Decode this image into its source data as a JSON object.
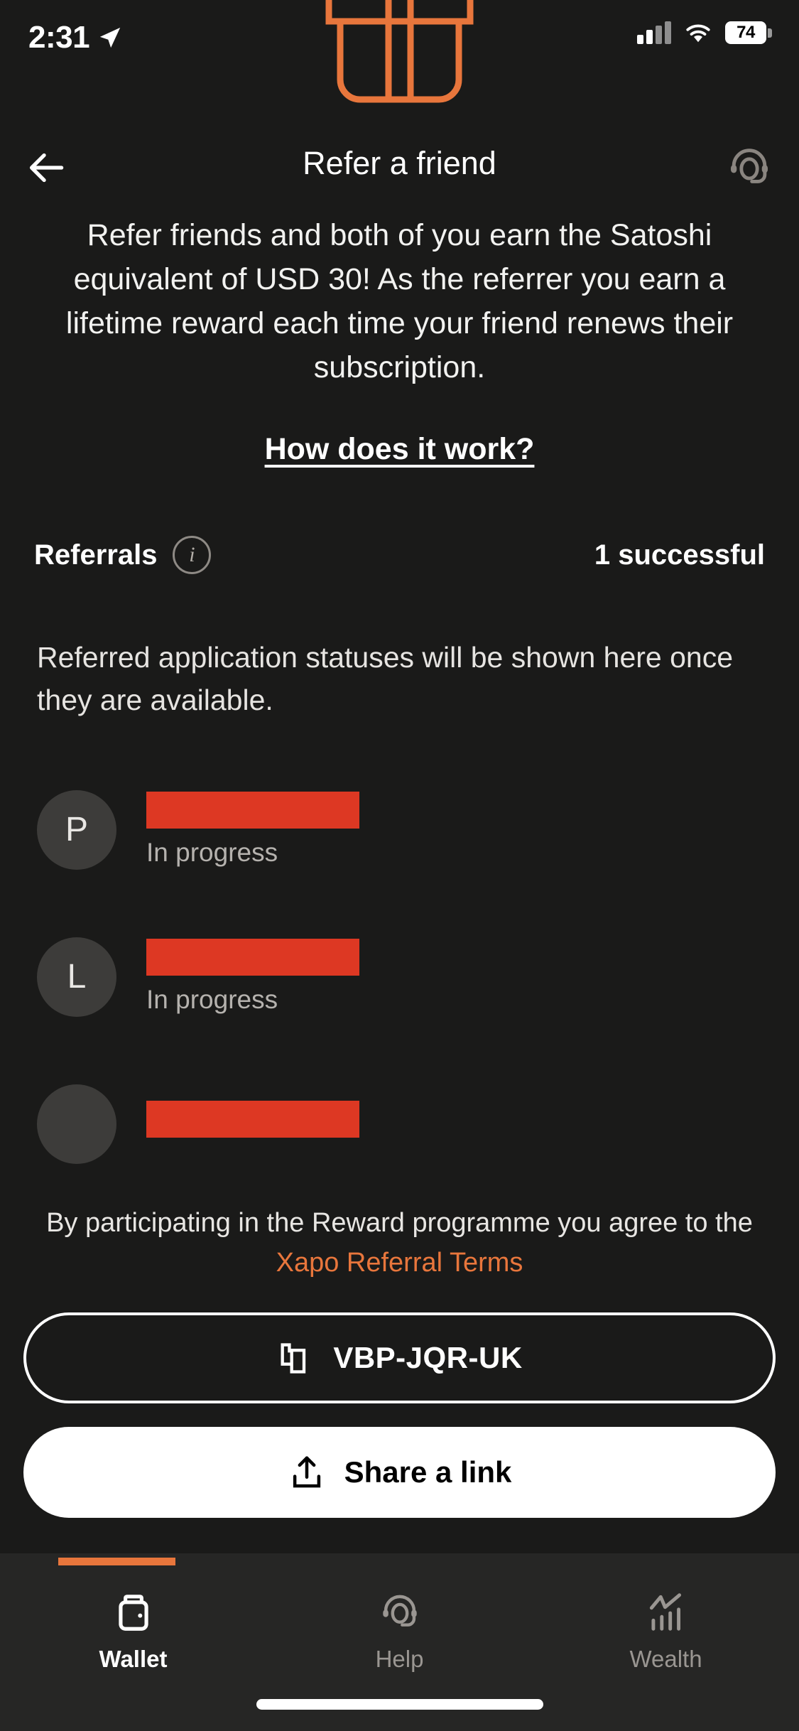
{
  "status_bar": {
    "time": "2:31",
    "location_icon": "location-arrow-icon",
    "signal_icon": "cellular-signal-icon",
    "wifi_icon": "wifi-icon",
    "battery_level": "74"
  },
  "notch_graphic": {
    "icon": "gift-box-icon",
    "color": "#e8763c"
  },
  "header": {
    "back_icon": "back-arrow-icon",
    "title": "Refer a friend",
    "support_icon": "headset-support-icon"
  },
  "intro": {
    "paragraph": "Refer friends and both of you earn the Satoshi equivalent of USD 30! As the referrer you earn a lifetime reward each time your friend renews their subscription.",
    "how_it_works_link": "How does it work?"
  },
  "referrals": {
    "label": "Referrals",
    "info_icon": "info-circle-icon",
    "count_text": "1 successful",
    "empty_note": "Referred application statuses will be shown here once they are available.",
    "items": [
      {
        "initial": "P",
        "name_redacted": true,
        "status": "In progress"
      },
      {
        "initial": "L",
        "name_redacted": true,
        "status": "In progress"
      },
      {
        "initial": "",
        "name_redacted": true,
        "status": ""
      }
    ]
  },
  "footer": {
    "terms_prefix": "By participating in the Reward programme you agree to the ",
    "terms_link": "Xapo Referral Terms",
    "copy_icon": "copy-icon",
    "referral_code": "VBP-JQR-UK",
    "share_icon": "share-upload-icon",
    "share_label": "Share a link"
  },
  "tabbar": {
    "active_color": "#e8763c",
    "tabs": [
      {
        "label": "Wallet",
        "icon": "wallet-icon",
        "active": true
      },
      {
        "label": "Help",
        "icon": "headset-icon",
        "active": false
      },
      {
        "label": "Wealth",
        "icon": "chart-growth-icon",
        "active": false
      }
    ]
  }
}
